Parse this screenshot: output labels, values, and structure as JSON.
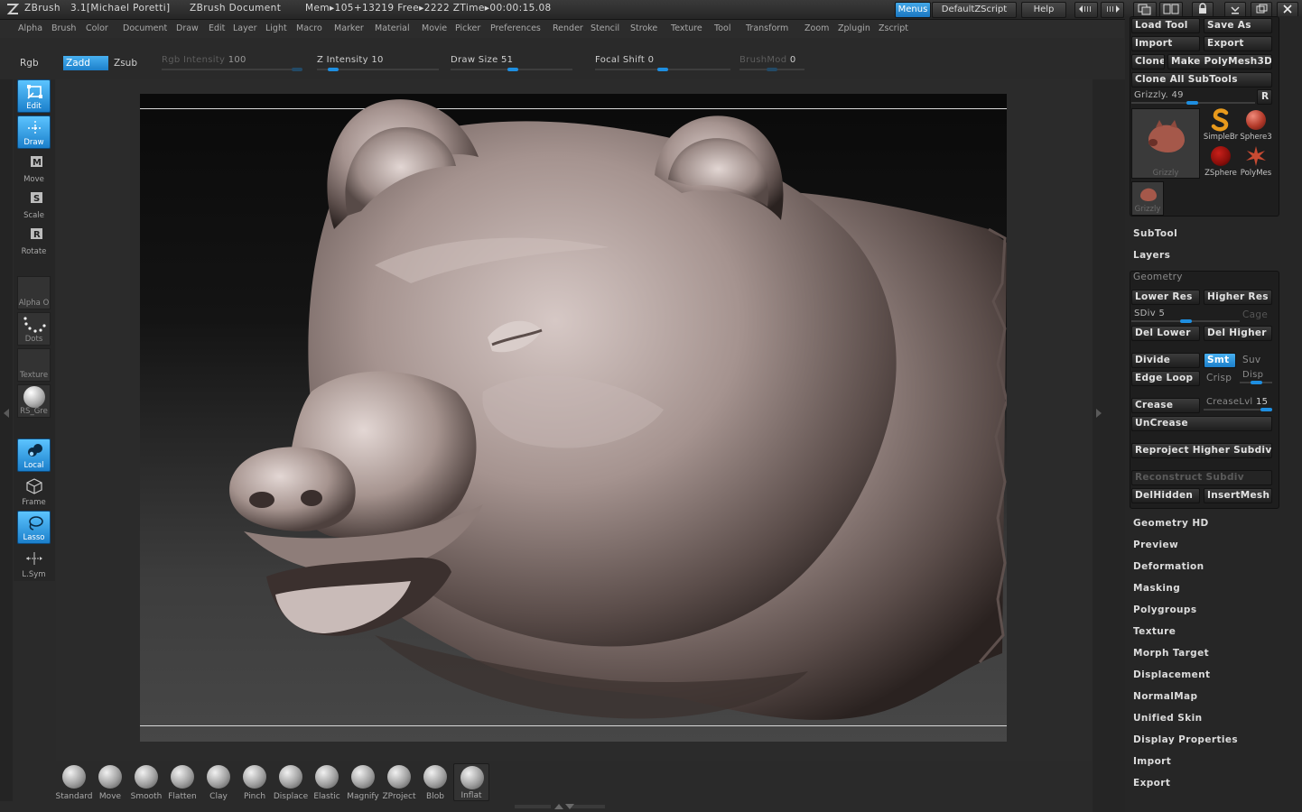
{
  "titlebar": {
    "app": "ZBrush",
    "version": "3.1[Michael Poretti]",
    "document": "ZBrush Document",
    "stats": "Mem▸105+13219  Free▸2222  ZTime▸00:00:15.08",
    "menus_btn": "Menus",
    "script_btn": "DefaultZScript",
    "help_btn": "Help"
  },
  "menubar": [
    "Alpha",
    "Brush",
    "Color",
    "Document",
    "Draw",
    "Edit",
    "Layer",
    "Light",
    "Macro",
    "Marker",
    "Material",
    "Movie",
    "Picker",
    "Preferences",
    "Render",
    "Stencil",
    "Stroke",
    "Texture",
    "Tool",
    "Transform",
    "Zoom",
    "Zplugin",
    "Zscript"
  ],
  "topshelf": {
    "rgb": "Rgb",
    "zadd": "Zadd",
    "zsub": "Zsub",
    "rgb_intensity_label": "Rgb  Intensity",
    "rgb_intensity": "100",
    "z_intensity_label": "Z  Intensity",
    "z_intensity": "10",
    "draw_size_label": "Draw  Size",
    "draw_size": "51",
    "focal_shift_label": "Focal  Shift",
    "focal_shift": "0",
    "brushmod_label": "BrushMod",
    "brushmod": "0",
    "levels": {
      "rgb_intensity": 1.0,
      "z_intensity": 0.1,
      "draw_size": 0.51,
      "focal_shift": 0.5,
      "brushmod": 0.5
    }
  },
  "lefttoolbar": {
    "edit": "Edit",
    "draw": "Draw",
    "move": "Move",
    "scale": "Scale",
    "rotate": "Rotate",
    "alpha": "Alpha  O",
    "dots": "Dots",
    "texture": "Texture",
    "material": "RS_Gre",
    "local": "Local",
    "frame": "Frame",
    "lasso": "Lasso",
    "lsym": "L.Sym"
  },
  "bottomshelf": {
    "brushes": [
      "Standard",
      "Move",
      "Smooth",
      "Flatten",
      "Clay",
      "Pinch",
      "Displace",
      "Elastic",
      "Magnify",
      "ZProject",
      "Blob",
      "Inflat"
    ]
  },
  "palette": {
    "load_tool": "Load  Tool",
    "save_as": "Save  As",
    "import": "Import",
    "export": "Export",
    "clone": "Clone",
    "make_polymesh": "Make  PolyMesh3D",
    "clone_all_subtools": "Clone  All  SubTools",
    "tool_name": "Grizzly.",
    "tool_value": "49",
    "tool_level": 0.49,
    "r_btn": "R",
    "thumbs": {
      "grizzly_main": "Grizzly",
      "simplebrush": "SimpleBr",
      "sphere3d": "Sphere3",
      "zsphere": "ZSphere",
      "polymesh": "PolyMes",
      "grizzly_small": "Grizzly"
    },
    "subtool": "SubTool",
    "layers": "Layers",
    "geometry": "Geometry",
    "lower_res": "Lower  Res",
    "higher_res": "Higher  Res",
    "sdiv_label": "SDiv",
    "sdiv_value": "5",
    "sdiv_level": 0.5,
    "cage": "Cage",
    "del_lower": "Del  Lower",
    "del_higher": "Del  Higher",
    "divide": "Divide",
    "smt": "Smt",
    "suv": "Suv",
    "edge_loop": "Edge  Loop",
    "crisp": "Crisp",
    "disp": "Disp",
    "crease": "Crease",
    "creaselvl_label": "CreaseLvl",
    "creaselvl_value": "15",
    "uncrease": "UnCrease",
    "reproject": "Reproject  Higher  Subdiv",
    "reconstruct": "Reconstruct  Subdiv",
    "delhidden": "DelHidden",
    "insertmesh": "InsertMesh",
    "sections": [
      "Geometry  HD",
      "Preview",
      "Deformation",
      "Masking",
      "Polygroups",
      "Texture",
      "Morph  Target",
      "Displacement",
      "NormalMap",
      "Unified  Skin",
      "Display  Properties",
      "Import",
      "Export"
    ]
  },
  "colors": {
    "accent": "#1e8ee0",
    "active_button": "#2f95dc",
    "panel": "#262626",
    "model_skin": "#9a8a86"
  }
}
